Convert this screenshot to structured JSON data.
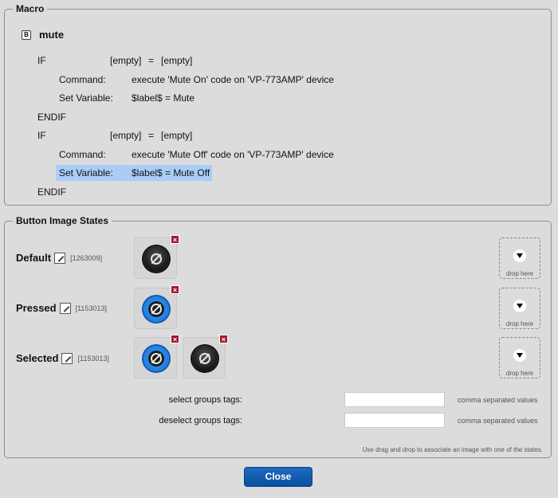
{
  "macro": {
    "legend": "Macro",
    "b_icon": "B",
    "name": "mute",
    "lines": [
      {
        "kw": "IF",
        "a": "[empty]",
        "op": "=",
        "b": "[empty]"
      },
      {
        "kw": "Command:",
        "text": "execute 'Mute On' code on 'VP-773AMP' device"
      },
      {
        "kw": "Set Variable:",
        "text": "$label$ = Mute"
      },
      {
        "kw": "ENDIF"
      },
      {
        "kw": "IF",
        "a": "[empty]",
        "op": "=",
        "b": "[empty]"
      },
      {
        "kw": "Command:",
        "text": "execute 'Mute Off' code on 'VP-773AMP' device"
      },
      {
        "kw": "Set Variable:",
        "text": "$label$ = Mute Off",
        "highlight": true
      },
      {
        "kw": "ENDIF"
      }
    ]
  },
  "states": {
    "legend": "Button Image States",
    "rows": [
      {
        "label": "Default",
        "id": "[1263009]"
      },
      {
        "label": "Pressed",
        "id": "[1153013]"
      },
      {
        "label": "Selected",
        "id": "[1153013]"
      }
    ],
    "remove_glyph": "×",
    "drop_label": "drop here",
    "select_tags_label": "select groups tags:",
    "deselect_tags_label": "deselect groups tags:",
    "select_tags_value": "",
    "deselect_tags_value": "",
    "hint": "comma separated values",
    "footer_note": "Use drag and drop to associate an image with one of the states."
  },
  "close_label": "Close",
  "colors": {
    "accent": "#0b4f9f",
    "highlight": "#a9cdf6",
    "remove": "#a4162b"
  }
}
